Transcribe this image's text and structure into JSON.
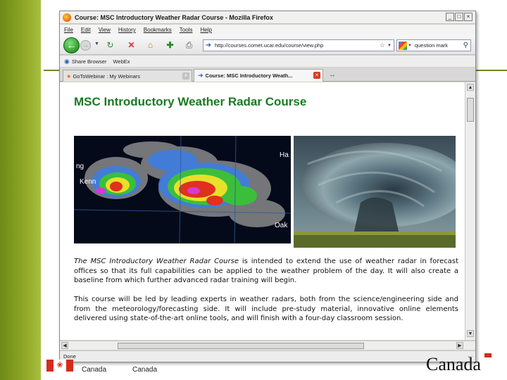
{
  "window": {
    "title": "Course: MSC Introductory Weather Radar Course - Mozilla Firefox",
    "controls": [
      "_",
      "□",
      "×"
    ]
  },
  "menu": [
    "File",
    "Edit",
    "View",
    "History",
    "Bookmarks",
    "Tools",
    "Help"
  ],
  "navigation": {
    "url": "http://courses.comet.ucar.edu/course/view.php",
    "search_value": "question mark"
  },
  "bookmarks": [
    "Share Browser",
    "WebEx"
  ],
  "tabs": [
    {
      "label": "GoToWebinar : My Webinars",
      "active": false
    },
    {
      "label": "Course: MSC Introductory Weath...",
      "active": true
    }
  ],
  "page": {
    "title": "MSC Introductory Weather Radar Course",
    "radar_labels": [
      "Ha",
      "ng",
      "Kenn",
      "Oak"
    ],
    "paragraph1_italic": "The MSC Introductory Weather Radar Course",
    "paragraph1_rest": " is intended to extend the use of weather radar in forecast offices so that its full capabilities can be applied to the weather problem of the day. It will also create a baseline from which further advanced radar training will begin.",
    "paragraph2": "This course will be led by leading experts in weather radars, both from the science/engineering side and from the meteorology/forecasting side. It will include pre-study material, innovative online elements delivered using state-of-the-art online tools, and will finish with a four-day classroom session."
  },
  "status": "Done",
  "footer": {
    "department_en": "Canada",
    "department_fr": "Canada",
    "wordmark": "Canada"
  },
  "colors": {
    "slide_green": "#8aa52a",
    "title_green": "#1a7a23",
    "canada_red": "#d52b1e"
  }
}
